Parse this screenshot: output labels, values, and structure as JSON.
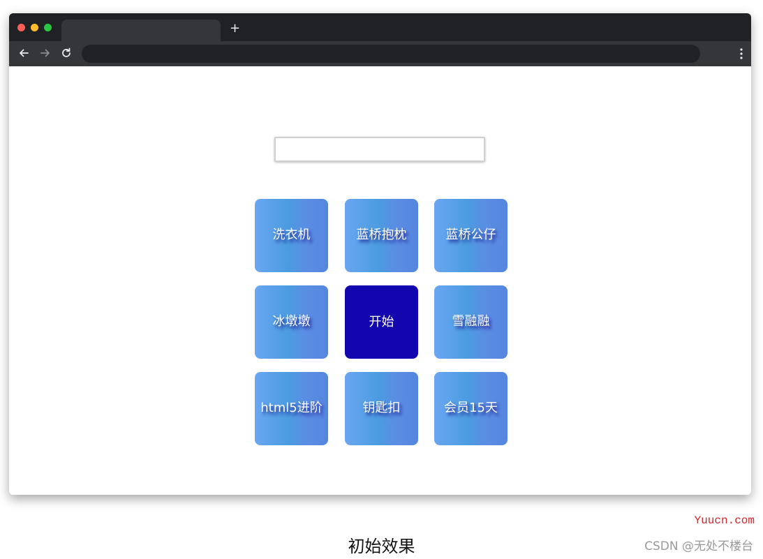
{
  "browser": {
    "new_tab_label": "+",
    "colors": {
      "titlebar": "#202124",
      "toolbar": "#35363a",
      "tab": "#35363a"
    },
    "icons": [
      "back-arrow-icon",
      "forward-arrow-icon",
      "reload-icon",
      "more-vert-icon"
    ]
  },
  "page": {
    "result_input": {
      "value": "",
      "placeholder": ""
    },
    "grid": {
      "cells": [
        {
          "label": "洗衣机",
          "type": "prize"
        },
        {
          "label": "蓝桥抱枕",
          "type": "prize"
        },
        {
          "label": "蓝桥公仔",
          "type": "prize"
        },
        {
          "label": "冰墩墩",
          "type": "prize"
        },
        {
          "label": "开始",
          "type": "start"
        },
        {
          "label": "雪融融",
          "type": "prize"
        },
        {
          "label": "html5进阶",
          "type": "prize"
        },
        {
          "label": "钥匙扣",
          "type": "prize"
        },
        {
          "label": "会员15天",
          "type": "prize"
        }
      ],
      "colors": {
        "prize_gradient_start": "#6aa6f2",
        "prize_gradient_end": "#5586df",
        "start": "#1206ae",
        "text_shadow": "#1b1b8f"
      }
    }
  },
  "caption": "初始效果",
  "watermark": {
    "site": "Yuucn.com",
    "author": "CSDN @无处不楼台"
  }
}
